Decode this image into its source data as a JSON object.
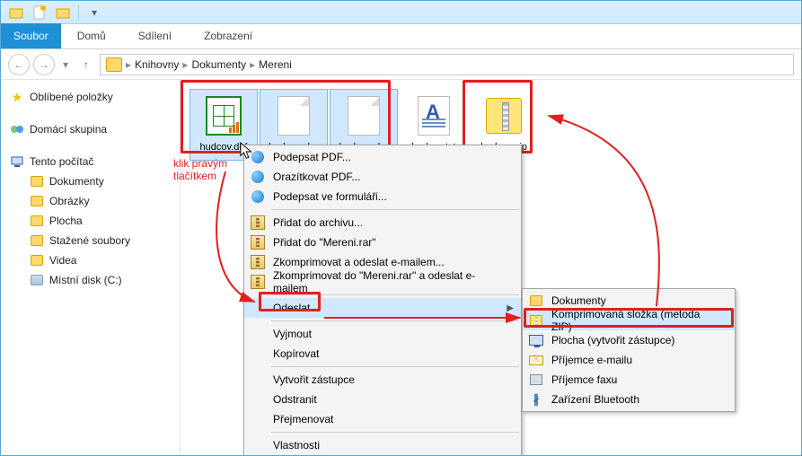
{
  "titlebar": {
    "qa_icons": [
      "window-icon",
      "new-doc-icon",
      "folder-icon"
    ]
  },
  "ribbon": {
    "file": "Soubor",
    "tabs": [
      "Domů",
      "Sdílení",
      "Zobrazení"
    ]
  },
  "breadcrumb": [
    "Knihovny",
    "Dokumenty",
    "Mereni"
  ],
  "sidebar": {
    "favorites": "Oblíbené položky",
    "homegroup": "Domácí skupina",
    "thispc": "Tento počítač",
    "items": [
      "Dokumenty",
      "Obrázky",
      "Plocha",
      "Stažené soubory",
      "Videa",
      "Místní disk (C:)"
    ]
  },
  "files": [
    {
      "name": "hudcov.dbf",
      "sel": true,
      "icon": "calc"
    },
    {
      "name": "hudcov.shp",
      "sel": true,
      "icon": "blank"
    },
    {
      "name": "hudcov.shx",
      "sel": true,
      "icon": "blank"
    },
    {
      "name": "hudcov.txt",
      "sel": false,
      "icon": "txt"
    },
    {
      "name": "hudcov.zip",
      "sel": false,
      "icon": "zip"
    }
  ],
  "annotation": {
    "line1": "klik pravým",
    "line2": "tlačítkem"
  },
  "context_main": {
    "group1": [
      "Podepsat PDF...",
      "Orazítkovat PDF...",
      "Podepsat ve formuláři..."
    ],
    "group2": [
      "Přidat do archivu...",
      "Přidat do \"Mereni.rar\"",
      "Zkomprimovat a odeslat e-mailem...",
      "Zkomprimovat do \"Mereni.rar\" a odeslat e-mailem"
    ],
    "send": "Odeslat",
    "group3": [
      "Vyjmout",
      "Kopírovat"
    ],
    "group4": [
      "Vytvořit zástupce",
      "Odstranit",
      "Přejmenovat"
    ],
    "group5": [
      "Vlastnosti"
    ]
  },
  "context_sub": [
    {
      "icon": "fld",
      "label": "Dokumenty"
    },
    {
      "icon": "zip",
      "label": "Komprimovaná složka (metoda ZIP)",
      "hl": true
    },
    {
      "icon": "disp",
      "label": "Plocha (vytvořit zástupce)"
    },
    {
      "icon": "mail",
      "label": "Příjemce e-mailu"
    },
    {
      "icon": "fax",
      "label": "Příjemce faxu"
    },
    {
      "icon": "bt",
      "label": "Zařízení Bluetooth"
    }
  ]
}
